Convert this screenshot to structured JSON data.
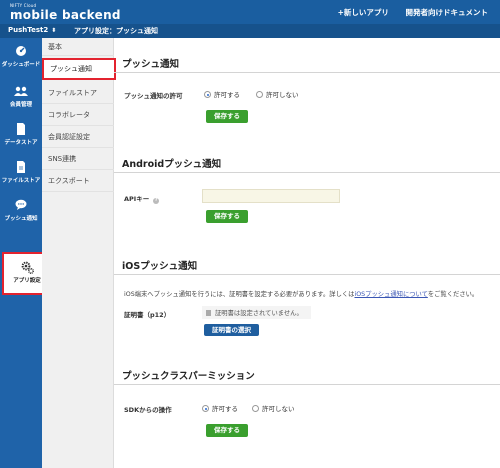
{
  "header": {
    "brand_small": "NIFTY Cloud",
    "brand": "mobile backend",
    "links": [
      "+新しいアプリ",
      "開発者向けドキュメント"
    ]
  },
  "subbar": {
    "app_name": "PushTest2",
    "caret": "⬍",
    "breadcrumb": "アプリ設定：プッシュ通知"
  },
  "leftnav": [
    {
      "label": "ダッシュボード",
      "icon": "dashboard-icon"
    },
    {
      "label": "会員管理",
      "icon": "users-icon"
    },
    {
      "label": "データストア",
      "icon": "datastore-icon"
    },
    {
      "label": "ファイルストア",
      "icon": "filestore-icon"
    },
    {
      "label": "プッシュ通知",
      "icon": "push-chat-icon"
    },
    {
      "label": "アプリ設定",
      "icon": "gears-icon",
      "active": true
    }
  ],
  "subnav": {
    "header": "基本",
    "items": [
      "プッシュ通知",
      "ファイルストア",
      "コラボレータ",
      "会員認証設定",
      "SNS連携",
      "エクスポート"
    ]
  },
  "push": {
    "title": "プッシュ通知",
    "permission_label": "プッシュ通知の許可",
    "allow": "許可する",
    "deny": "許可しない",
    "save": "保存する"
  },
  "android": {
    "title": "Androidプッシュ通知",
    "api_key_label": "APIキー",
    "help": "?",
    "api_key_value": "",
    "save": "保存する"
  },
  "ios": {
    "title": "iOSプッシュ通知",
    "desc_before": "iOS端末へプッシュ通知を行うには、証明書を設定する必要があります。詳しくは",
    "desc_link": "iOSプッシュ通知について",
    "desc_after": "をご覧ください。",
    "cert_label": "証明書（p12）",
    "cert_status": "証明書は設定されていません。",
    "select_button": "証明書の選択"
  },
  "pushclass": {
    "title": "プッシュクラスパーミッション",
    "sdk_label": "SDKからの操作",
    "allow": "許可する",
    "deny": "許可しない",
    "save": "保存する"
  },
  "colors": {
    "header_blue": "#1a5ea0",
    "save_green": "#3a9f2e",
    "highlight_red": "#e3232f"
  }
}
